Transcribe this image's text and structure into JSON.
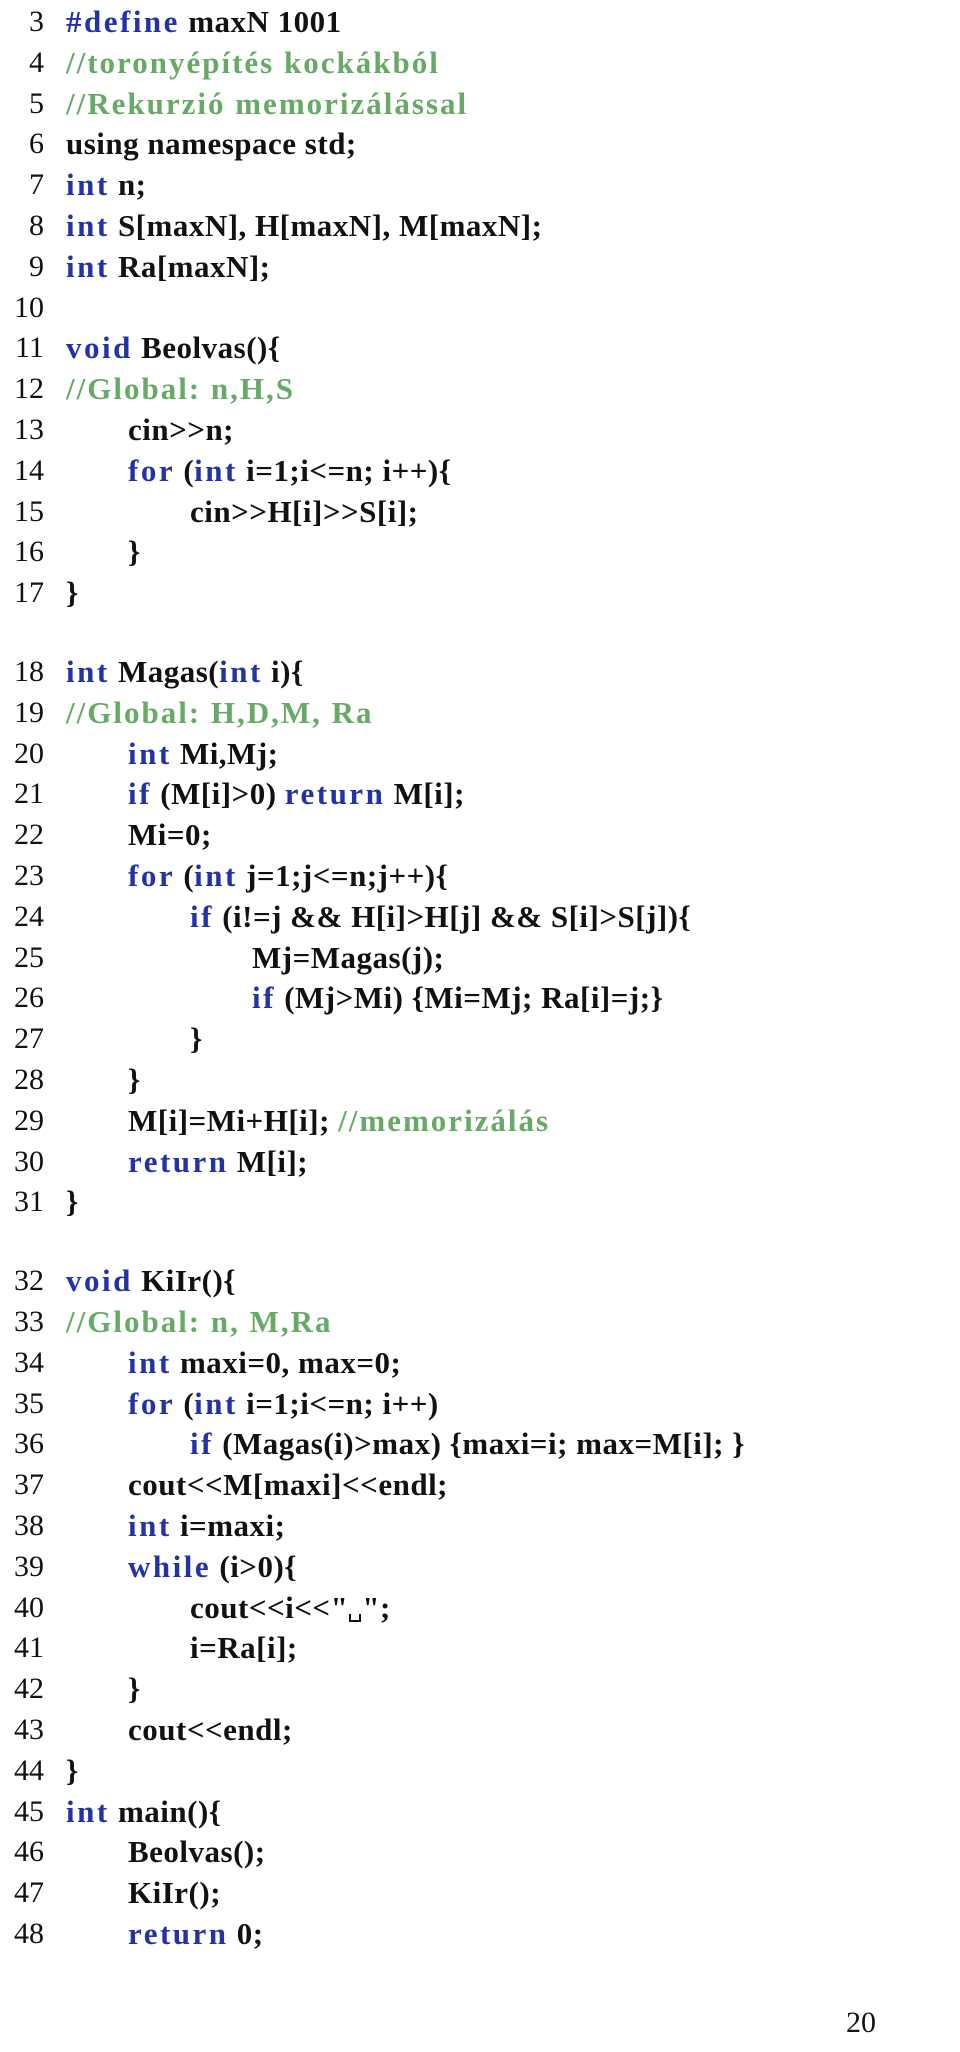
{
  "colors": {
    "keyword": "#2233aa",
    "comment": "#66aa66",
    "text": "#111111"
  },
  "indent_unit": "    ",
  "lines": [
    {
      "n": "3",
      "indent": 0,
      "tokens": [
        {
          "t": "kw",
          "v": "#define"
        },
        {
          "t": "tx",
          "v": " maxN 1001"
        }
      ]
    },
    {
      "n": "4",
      "indent": 0,
      "tokens": [
        {
          "t": "cm",
          "v": "//toronyépítés kockákból"
        }
      ]
    },
    {
      "n": "5",
      "indent": 0,
      "tokens": [
        {
          "t": "cm",
          "v": "//Rekurzió memorizálással"
        }
      ]
    },
    {
      "n": "6",
      "indent": 0,
      "tokens": [
        {
          "t": "tx",
          "v": "using namespace std;"
        }
      ]
    },
    {
      "n": "7",
      "indent": 0,
      "tokens": [
        {
          "t": "kw",
          "v": "int"
        },
        {
          "t": "tx",
          "v": " n;"
        }
      ]
    },
    {
      "n": "8",
      "indent": 0,
      "tokens": [
        {
          "t": "kw",
          "v": "int"
        },
        {
          "t": "tx",
          "v": " S[maxN], H[maxN], M[maxN];"
        }
      ]
    },
    {
      "n": "9",
      "indent": 0,
      "tokens": [
        {
          "t": "kw",
          "v": "int"
        },
        {
          "t": "tx",
          "v": " Ra[maxN];"
        }
      ]
    },
    {
      "n": "10",
      "indent": 0,
      "tokens": []
    },
    {
      "n": "11",
      "indent": 0,
      "tokens": [
        {
          "t": "kw",
          "v": "void"
        },
        {
          "t": "tx",
          "v": " Beolvas(){"
        }
      ]
    },
    {
      "n": "12",
      "indent": 0,
      "tokens": [
        {
          "t": "cm",
          "v": "//Global: n,H,S"
        }
      ]
    },
    {
      "n": "13",
      "indent": 1,
      "tokens": [
        {
          "t": "tx",
          "v": "cin>>n;"
        }
      ]
    },
    {
      "n": "14",
      "indent": 1,
      "tokens": [
        {
          "t": "kw",
          "v": "for"
        },
        {
          "t": "tx",
          "v": " ("
        },
        {
          "t": "kw",
          "v": "int"
        },
        {
          "t": "tx",
          "v": " i=1;i<=n; i++){"
        }
      ]
    },
    {
      "n": "15",
      "indent": 2,
      "tokens": [
        {
          "t": "tx",
          "v": "cin>>H[i]>>S[i];"
        }
      ]
    },
    {
      "n": "16",
      "indent": 1,
      "tokens": [
        {
          "t": "tx",
          "v": "}"
        }
      ]
    },
    {
      "n": "17",
      "indent": 0,
      "tokens": [
        {
          "t": "tx",
          "v": "}"
        }
      ]
    },
    {
      "n": "18",
      "indent": 0,
      "gap": true,
      "tokens": [
        {
          "t": "kw",
          "v": "int"
        },
        {
          "t": "tx",
          "v": " Magas("
        },
        {
          "t": "kw",
          "v": "int"
        },
        {
          "t": "tx",
          "v": " i){"
        }
      ]
    },
    {
      "n": "19",
      "indent": 0,
      "tokens": [
        {
          "t": "cm",
          "v": "//Global: H,D,M, Ra"
        }
      ]
    },
    {
      "n": "20",
      "indent": 1,
      "tokens": [
        {
          "t": "kw",
          "v": "int"
        },
        {
          "t": "tx",
          "v": " Mi,Mj;"
        }
      ]
    },
    {
      "n": "21",
      "indent": 1,
      "tokens": [
        {
          "t": "kw",
          "v": "if"
        },
        {
          "t": "tx",
          "v": " (M[i]>0) "
        },
        {
          "t": "kw",
          "v": "return"
        },
        {
          "t": "tx",
          "v": " M[i];"
        }
      ]
    },
    {
      "n": "22",
      "indent": 1,
      "tokens": [
        {
          "t": "tx",
          "v": "Mi=0;"
        }
      ]
    },
    {
      "n": "23",
      "indent": 1,
      "tokens": [
        {
          "t": "kw",
          "v": "for"
        },
        {
          "t": "tx",
          "v": " ("
        },
        {
          "t": "kw",
          "v": "int"
        },
        {
          "t": "tx",
          "v": " j=1;j<=n;j++){"
        }
      ]
    },
    {
      "n": "24",
      "indent": 2,
      "tokens": [
        {
          "t": "kw",
          "v": "if"
        },
        {
          "t": "tx",
          "v": " (i!=j && H[i]>H[j] && S[i]>S[j]){"
        }
      ]
    },
    {
      "n": "25",
      "indent": 3,
      "tokens": [
        {
          "t": "tx",
          "v": "Mj=Magas(j);"
        }
      ]
    },
    {
      "n": "26",
      "indent": 3,
      "tokens": [
        {
          "t": "kw",
          "v": "if"
        },
        {
          "t": "tx",
          "v": " (Mj>Mi) {Mi=Mj; Ra[i]=j;}"
        }
      ]
    },
    {
      "n": "27",
      "indent": 2,
      "tokens": [
        {
          "t": "tx",
          "v": "}"
        }
      ]
    },
    {
      "n": "28",
      "indent": 1,
      "tokens": [
        {
          "t": "tx",
          "v": "}"
        }
      ]
    },
    {
      "n": "29",
      "indent": 1,
      "tokens": [
        {
          "t": "tx",
          "v": "M[i]=Mi+H[i]; "
        },
        {
          "t": "cm",
          "v": "//memorizálás"
        }
      ]
    },
    {
      "n": "30",
      "indent": 1,
      "tokens": [
        {
          "t": "kw",
          "v": "return"
        },
        {
          "t": "tx",
          "v": " M[i];"
        }
      ]
    },
    {
      "n": "31",
      "indent": 0,
      "tokens": [
        {
          "t": "tx",
          "v": "}"
        }
      ]
    },
    {
      "n": "32",
      "indent": 0,
      "gap": true,
      "tokens": [
        {
          "t": "kw",
          "v": "void"
        },
        {
          "t": "tx",
          "v": " KiIr(){"
        }
      ]
    },
    {
      "n": "33",
      "indent": 0,
      "tokens": [
        {
          "t": "cm",
          "v": "//Global: n, M,Ra"
        }
      ]
    },
    {
      "n": "34",
      "indent": 1,
      "tokens": [
        {
          "t": "kw",
          "v": "int"
        },
        {
          "t": "tx",
          "v": " maxi=0, max=0;"
        }
      ]
    },
    {
      "n": "35",
      "indent": 1,
      "tokens": [
        {
          "t": "kw",
          "v": "for"
        },
        {
          "t": "tx",
          "v": " ("
        },
        {
          "t": "kw",
          "v": "int"
        },
        {
          "t": "tx",
          "v": " i=1;i<=n; i++)"
        }
      ]
    },
    {
      "n": "36",
      "indent": 2,
      "tokens": [
        {
          "t": "kw",
          "v": "if"
        },
        {
          "t": "tx",
          "v": " (Magas(i)>max) {maxi=i; max=M[i]; }"
        }
      ]
    },
    {
      "n": "37",
      "indent": 1,
      "tokens": [
        {
          "t": "tx",
          "v": "cout<<M[maxi]<<endl;"
        }
      ]
    },
    {
      "n": "38",
      "indent": 1,
      "tokens": [
        {
          "t": "kw",
          "v": "int"
        },
        {
          "t": "tx",
          "v": " i=maxi;"
        }
      ]
    },
    {
      "n": "39",
      "indent": 1,
      "tokens": [
        {
          "t": "kw",
          "v": "while"
        },
        {
          "t": "tx",
          "v": " (i>0){"
        }
      ]
    },
    {
      "n": "40",
      "indent": 2,
      "tokens": [
        {
          "t": "tx",
          "v": "cout<<i<<\""
        },
        {
          "t": "space",
          "v": " "
        },
        {
          "t": "tx",
          "v": "\";"
        }
      ]
    },
    {
      "n": "41",
      "indent": 2,
      "tokens": [
        {
          "t": "tx",
          "v": "i=Ra[i];"
        }
      ]
    },
    {
      "n": "42",
      "indent": 1,
      "tokens": [
        {
          "t": "tx",
          "v": "}"
        }
      ]
    },
    {
      "n": "43",
      "indent": 1,
      "tokens": [
        {
          "t": "tx",
          "v": "cout<<endl;"
        }
      ]
    },
    {
      "n": "44",
      "indent": 0,
      "tokens": [
        {
          "t": "tx",
          "v": "}"
        }
      ]
    },
    {
      "n": "45",
      "indent": 0,
      "tokens": [
        {
          "t": "kw",
          "v": "int"
        },
        {
          "t": "tx",
          "v": " main(){"
        }
      ]
    },
    {
      "n": "46",
      "indent": 1,
      "tokens": [
        {
          "t": "tx",
          "v": "Beolvas();"
        }
      ]
    },
    {
      "n": "47",
      "indent": 1,
      "tokens": [
        {
          "t": "tx",
          "v": "KiIr();"
        }
      ]
    },
    {
      "n": "48",
      "indent": 1,
      "tokens": [
        {
          "t": "kw",
          "v": "return"
        },
        {
          "t": "tx",
          "v": " 0;"
        }
      ]
    }
  ],
  "page_number": "20"
}
